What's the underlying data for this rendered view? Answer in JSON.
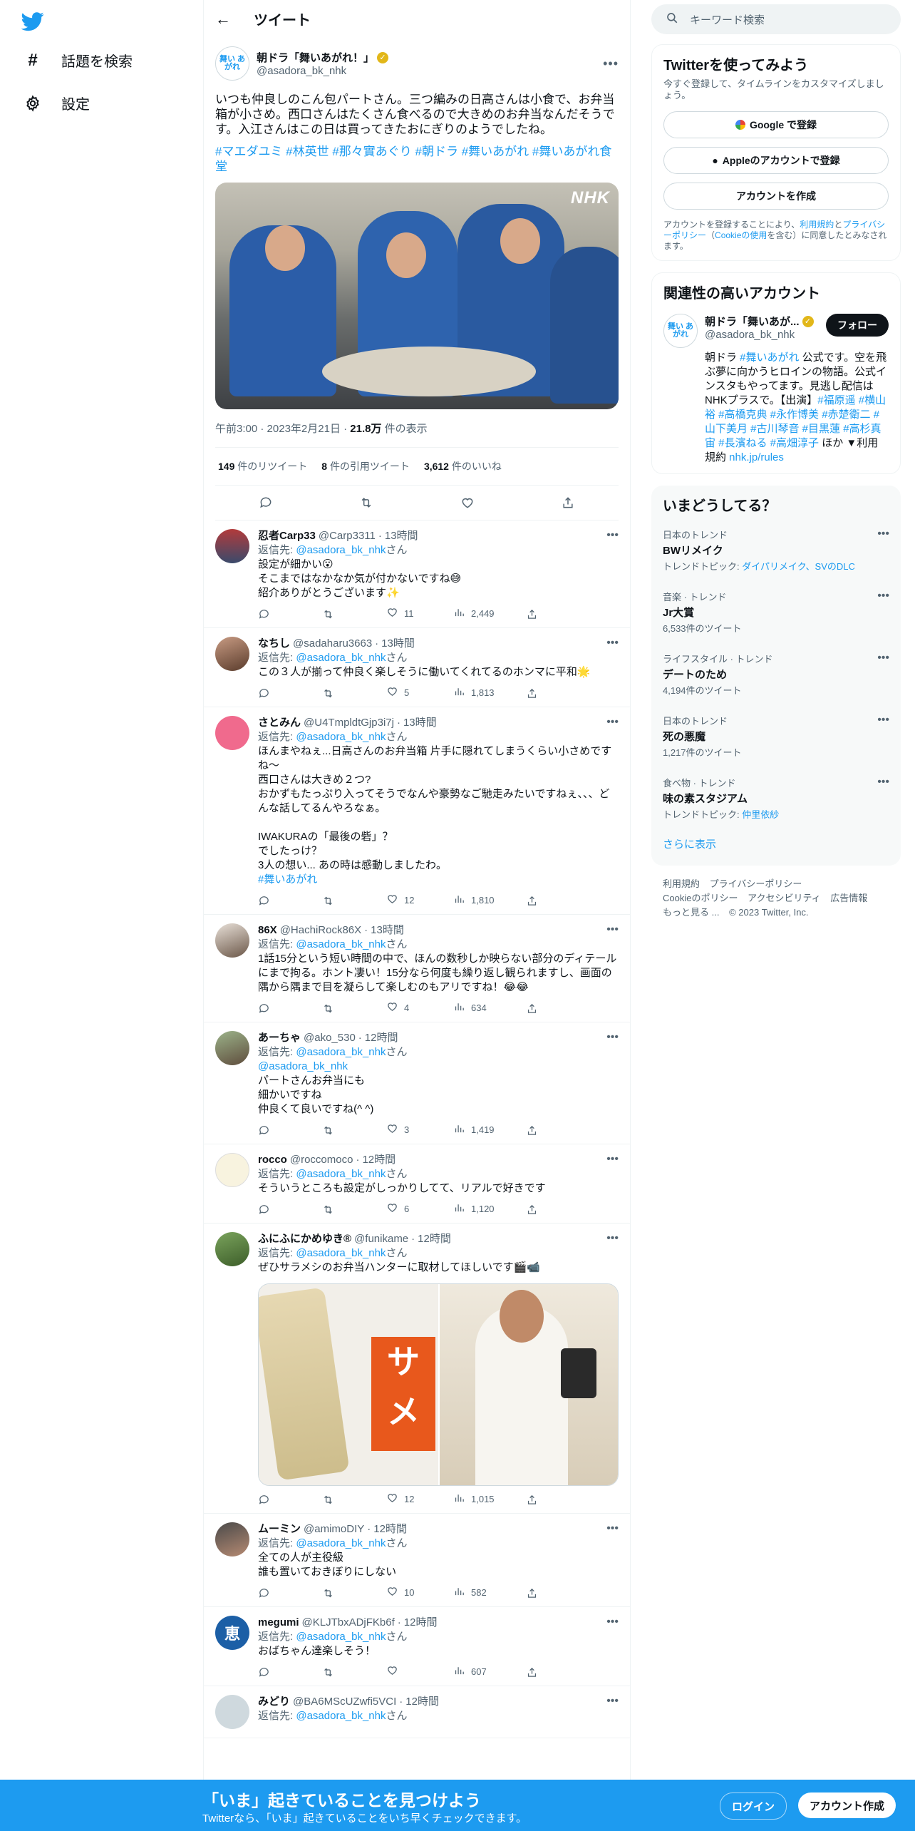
{
  "nav": {
    "items": [
      {
        "label": "話題を検索",
        "icon": "hashtag-icon"
      },
      {
        "label": "設定",
        "icon": "gear-icon"
      }
    ]
  },
  "header": {
    "title": "ツイート"
  },
  "main_tweet": {
    "name": "朝ドラ「舞いあがれ！」",
    "handle": "@asadora_bk_nhk",
    "avatar_text": "舞い あがれ",
    "text": "いつも仲良しのこん包パートさん。三つ編みの日高さんは小食で、お弁当箱が小さめ。西口さんはたくさん食べるので大きめのお弁当なんだそうです。入江さんはこの日は買ってきたおにぎりのようでしたね。",
    "hashtags": "#マエダユミ #林英世 #那々實あぐり #朝ドラ #舞いあがれ #舞いあがれ食堂",
    "photo_watermark": "NHK",
    "time": "午前3:00",
    "date": "2023年2月21日",
    "views_num": "21.8万",
    "views_label": "件の表示",
    "retweets_num": "149",
    "retweets_label": "件のリツイート",
    "quotes_num": "8",
    "quotes_label": "件の引用ツイート",
    "likes_num": "3,612",
    "likes_label": "件のいいね"
  },
  "reply_to_label": "返信先: ",
  "reply_to_handle": "@asadora_bk_nhk",
  "reply_to_suffix": "さん",
  "replies": [
    {
      "name": "忍者Carp33",
      "handle": "@Carp3311",
      "time": "13時間",
      "text": "設定が細かい😮\nそこまではなかなか気が付かないですね😅\n紹介ありがとうございます✨",
      "likes": "11",
      "views": "2,449"
    },
    {
      "name": "なちし",
      "handle": "@sadaharu3663",
      "time": "13時間",
      "text": "この３人が揃って仲良く楽しそうに働いてくれてるのホンマに平和🌟",
      "likes": "5",
      "views": "1,813"
    },
    {
      "name": "さとみん",
      "handle": "@U4TmpldtGjp3i7j",
      "time": "13時間",
      "text": "ほんまやねぇ...日高さんのお弁当箱 片手に隠れてしまうくらい小さめですね〜\n西口さんは大きめ２つ?\nおかずもたっぷり入ってそうでなんや豪勢なご馳走みたいですねぇ、、、どんな話してるんやろなぁ。\n\nIWAKURAの「最後の砦」？\nでしたっけ？\n3人の想い... あの時は感動しましたわ。",
      "tag": "#舞いあがれ",
      "likes": "12",
      "views": "1,810"
    },
    {
      "name": "86X",
      "handle": "@HachiRock86X",
      "time": "13時間",
      "text": "1話15分という短い時間の中で、ほんの数秒しか映らない部分のディテールにまで拘る。ホント凄い！15分なら何度も繰り返し観られますし、画面の隅から隅まで目を凝らして楽しむのもアリですね！😂😂",
      "likes": "4",
      "views": "634"
    },
    {
      "name": "あーちゃ",
      "handle": "@ako_530",
      "time": "12時間",
      "mention": "@asadora_bk_nhk",
      "text": "パートさんお弁当にも\n細かいですね\n仲良くて良いですね(^ ^)",
      "likes": "3",
      "views": "1,419"
    },
    {
      "name": "rocco",
      "handle": "@roccomoco",
      "time": "12時間",
      "text": "そういうところも設定がしっかりしてて、リアルで好きです",
      "likes": "6",
      "views": "1,120"
    },
    {
      "name": "ふにふにかめゆき®",
      "handle": "@funikame",
      "time": "12時間",
      "text": "ぜひサラメシのお弁当ハンターに取材してほしいです🎬📹",
      "media_text": "サメ",
      "likes": "12",
      "views": "1,015"
    },
    {
      "name": "ムーミン",
      "handle": "@amimoDIY",
      "time": "12時間",
      "text": "全ての人が主役級\n誰も置いておきぼりにしない",
      "likes": "10",
      "views": "582"
    },
    {
      "name": "megumi",
      "handle": "@KLJTbxADjFKb6f",
      "time": "12時間",
      "avatar_text": "恵",
      "text": "おばちゃん達楽しそう！",
      "likes": "",
      "views": "607"
    },
    {
      "name": "みどり",
      "handle": "@BA6MScUZwfi5VCI",
      "time": "12時間",
      "text": "",
      "likes": "",
      "views": ""
    }
  ],
  "right": {
    "search_placeholder": "キーワード検索",
    "signup": {
      "title": "Twitterを使ってみよう",
      "subtitle": "今すぐ登録して、タイムラインをカスタマイズしましょう。",
      "google": "Google で登録",
      "apple": "Appleのアカウントで登録",
      "create": "アカウントを作成",
      "legal_1": "アカウントを登録することにより、",
      "legal_terms": "利用規約",
      "legal_2": "と",
      "legal_privacy": "プライバシーポリシー",
      "legal_3": "（",
      "legal_cookie": "Cookieの使用",
      "legal_4": "を含む）に同意したとみなされます。"
    },
    "related": {
      "title": "関連性の高いアカウント",
      "name": "朝ドラ「舞いあが...",
      "handle": "@asadora_bk_nhk",
      "follow": "フォロー",
      "bio_1": "朝ドラ ",
      "bio_tag1": "#舞いあがれ",
      "bio_2": " 公式です。空を飛ぶ夢に向かうヒロインの物語。公式インスタもやってます。見逃し配信はNHKプラスで。【出演】",
      "bio_tags": "#福原遥 #横山裕 #高橋克典 #永作博美 #赤楚衛二 #山下美月 #古川琴音 #目黒蓮 #高杉真宙 #長濱ねる #高畑淳子",
      "bio_3": " ほか ▼利用規約 ",
      "bio_link": "nhk.jp/rules"
    },
    "trends": {
      "title": "いまどうしてる？",
      "items": [
        {
          "category": "日本のトレンド",
          "name": "BWリメイク",
          "extra_label": "トレンドトピック: ",
          "extra_link": "ダイパリメイク、SVのDLC"
        },
        {
          "category": "音楽 · トレンド",
          "name": "Jr大賞",
          "count": "6,533件のツイート"
        },
        {
          "category": "ライフスタイル · トレンド",
          "name": "デートのため",
          "count": "4,194件のツイート"
        },
        {
          "category": "日本のトレンド",
          "name": "死の悪魔",
          "count": "1,217件のツイート"
        },
        {
          "category": "食べ物 · トレンド",
          "name": "味の素スタジアム",
          "extra_label": "トレンドトピック: ",
          "extra_link": "仲里依紗"
        }
      ],
      "show_more": "さらに表示"
    },
    "footer": {
      "links": [
        "利用規約",
        "プライバシーポリシー",
        "Cookieのポリシー",
        "アクセシビリティ",
        "広告情報",
        "もっと見る ..."
      ],
      "copyright": "© 2023 Twitter, Inc."
    }
  },
  "banner": {
    "headline": "「いま」起きていることを見つけよう",
    "sub": "Twitterなら、「いま」起きていることをいち早くチェックできます。",
    "login": "ログイン",
    "signup": "アカウント作成"
  },
  "colors": {
    "brand": "#1d9bf0",
    "text": "#0f1419",
    "secondary": "#536471",
    "border": "#eff3f4"
  }
}
